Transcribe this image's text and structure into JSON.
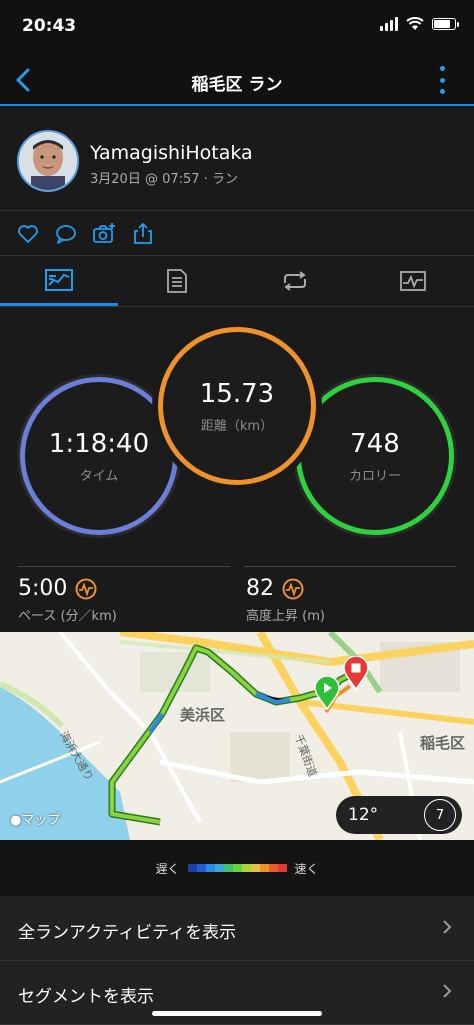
{
  "status_bar": {
    "time": "20:43"
  },
  "nav": {
    "title": "稲毛区 ラン"
  },
  "profile": {
    "name": "YamagishiHotaka",
    "subtitle": "3月20日 @ 07:57 · ラン"
  },
  "stats": {
    "time": {
      "value": "1:18:40",
      "label": "タイム",
      "color": "#5b7fd9"
    },
    "distance": {
      "value": "15.73",
      "label": "距離（km）",
      "color": "#f0922b"
    },
    "calories": {
      "value": "748",
      "label": "カロリー",
      "color": "#2fd13f"
    }
  },
  "metrics": {
    "pace": {
      "value": "5:00",
      "label": "ペース (分／km)"
    },
    "elevation": {
      "value": "82",
      "label": "高度上昇 (m)"
    }
  },
  "map": {
    "area_labels": [
      "美浜区",
      "稲毛区"
    ],
    "road_labels": [
      "海浜大通り",
      "千葉街道"
    ],
    "attribution": "マップ",
    "temperature": "12°",
    "wind": "7"
  },
  "legend": {
    "slow": "遅く",
    "fast": "速く"
  },
  "list": [
    {
      "label": "全ランアクティビティを表示"
    },
    {
      "label": "セグメントを表示"
    }
  ],
  "colors": {
    "accent": "#1e88e5",
    "orange": "#f0922b",
    "green": "#2fd13f"
  }
}
